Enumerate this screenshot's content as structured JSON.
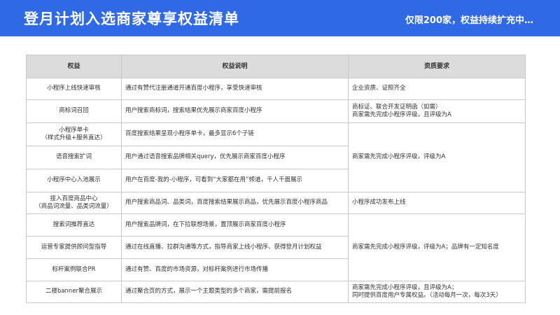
{
  "header": {
    "title": "登月计划入选商家尊享权益清单",
    "subtitle": "仅限200家，权益持续扩充中…",
    "bg_color": "#2f69e6"
  },
  "table": {
    "headers": [
      "权益",
      "权益说明",
      "资质要求"
    ],
    "rows": [
      {
        "benefit": "小程序上线快速审核",
        "desc": "通过有赞代注册通道开通百度小程序，享受快速审核",
        "req": "企业资质、证照齐全"
      },
      {
        "benefit": "商标词召回",
        "desc": "用户搜索商标词，搜索结果优先展示商家百度小程序",
        "req": "商标证、联合开发证明函（如需）\n商家需先完成小程序评级，且评级为A"
      },
      {
        "benefit": "小程序单卡\n（样式升级+服务直达）",
        "desc": "百度搜索结果呈现小程序单卡，最多显示6个子链",
        "req": "商家需先完成小程序评级，评级为A"
      },
      {
        "benefit": "语音搜索扩词",
        "desc": "用户通过语音搜索品牌相关query，优先展示商家百度小程序"
      },
      {
        "benefit": "小程序中心入池展示",
        "desc": "用户在百度-我的-小程序，可看到“大家都在用”频道，千人千面展示"
      },
      {
        "benefit": "接入百度商品中心\n（商品词流量、品类词流量）",
        "desc": "用户搜索商品词、品类词，百度搜索结果展示商品，优先展示百度小程序商品",
        "req": "小程序成功发布上线"
      },
      {
        "benefit": "搜索词推荐直达",
        "desc": "用户搜索品牌词，在下拉联想场景，置顶展示商家百度小程序",
        "req": "商家需先完成小程序评级，评级为A；品牌有一定知名度"
      },
      {
        "benefit": "运营专家提供顾问型指导",
        "desc": "通过在线直播、拉群沟通等方式，指导商家上线小程序、获得登月计划权益"
      },
      {
        "benefit": "标杆案例联合PR",
        "desc": "通过有赞、百度的市场资源，对标杆案例进行市场传播"
      },
      {
        "benefit": "二楼banner聚合展示",
        "desc": "通过聚合页的方式，展示一个主题类型的多个商家，需提前报名",
        "req": "商家需先完成小程序评级，且评级为A；\n同时提供百度用户专属权益。（活动每月一次，每次3天）"
      }
    ]
  }
}
